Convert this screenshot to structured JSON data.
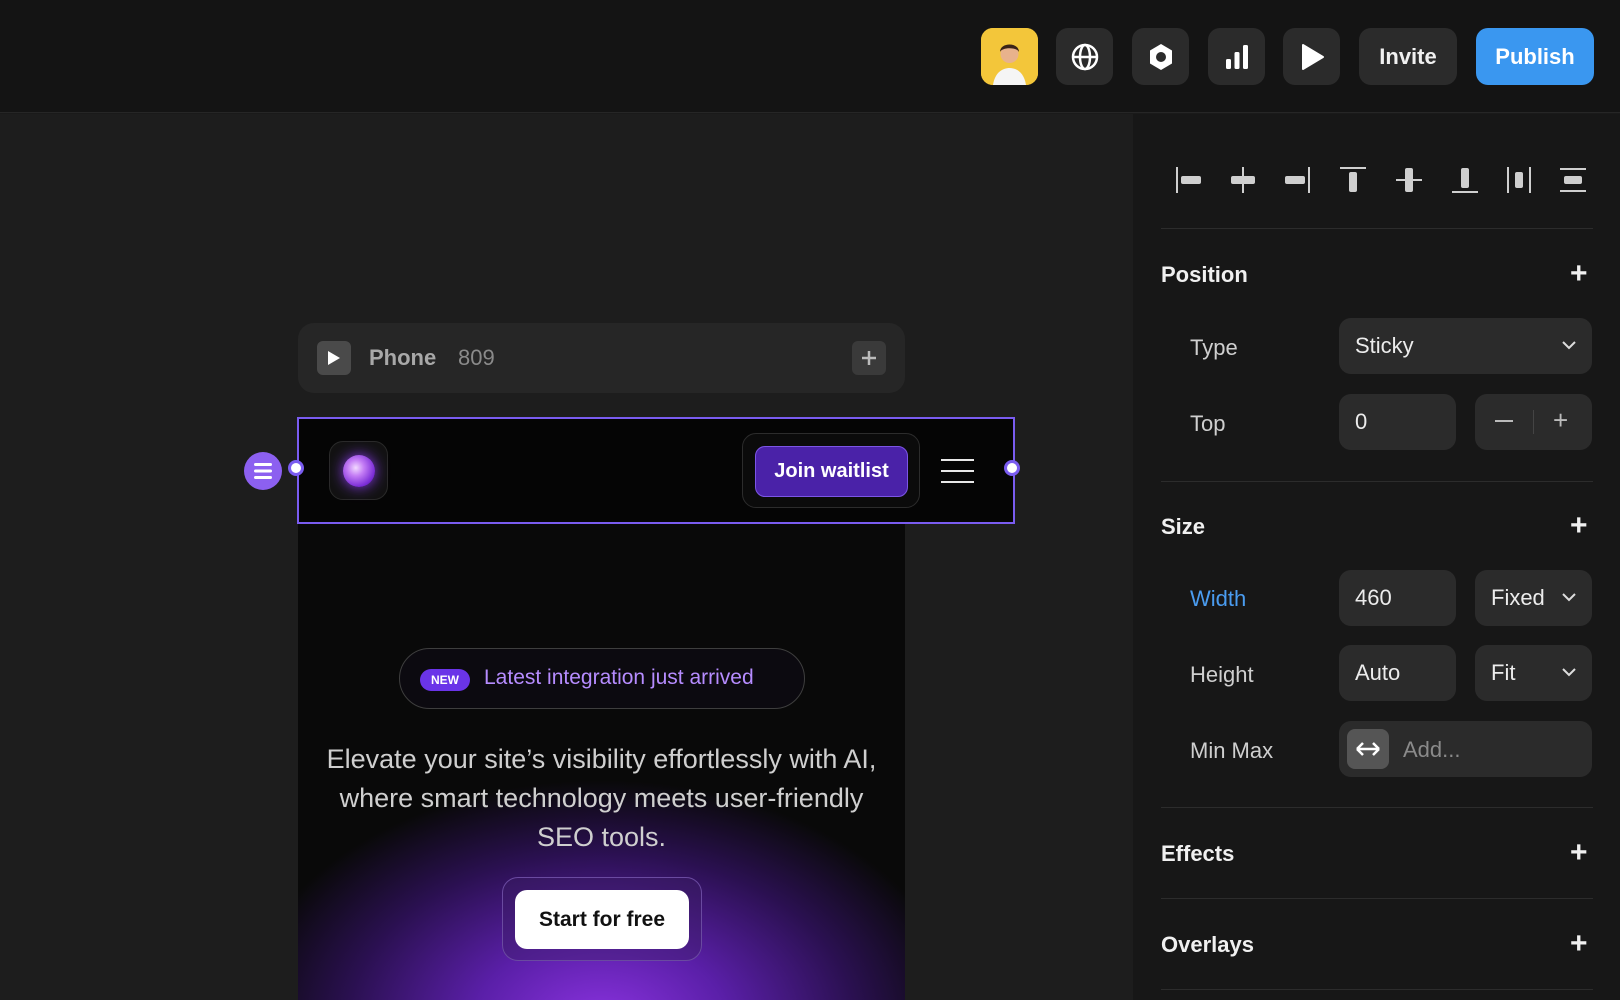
{
  "topbar": {
    "avatar": "user-avatar",
    "icons": [
      "globe-icon",
      "hexagon-icon",
      "bar-chart-icon",
      "play-icon"
    ],
    "invite_label": "Invite",
    "publish_label": "Publish"
  },
  "canvas": {
    "frame_label": {
      "name": "Phone",
      "width": "809"
    },
    "navbar": {
      "cta_label": "Join waitlist"
    },
    "badge": {
      "tag": "NEW",
      "text": "Latest integration just arrived"
    },
    "hero_text": "Elevate your site’s visibility effortlessly with AI, where smart technology meets user-friendly SEO tools.",
    "cta_label": "Start for free"
  },
  "panel": {
    "align_icons": [
      "align-left-icon",
      "align-center-h-icon",
      "align-right-icon",
      "align-top-icon",
      "align-center-v-icon",
      "align-bottom-icon",
      "distribute-h-icon",
      "distribute-v-icon"
    ],
    "position": {
      "title": "Position",
      "type_label": "Type",
      "type_value": "Sticky",
      "top_label": "Top",
      "top_value": "0"
    },
    "size": {
      "title": "Size",
      "width_label": "Width",
      "width_value": "460",
      "width_mode": "Fixed",
      "height_label": "Height",
      "height_value": "Auto",
      "height_mode": "Fit",
      "minmax_label": "Min Max",
      "minmax_placeholder": "Add..."
    },
    "effects_title": "Effects",
    "overlays_title": "Overlays"
  },
  "colors": {
    "accent_blue": "#3a97f0",
    "selection_purple": "#7a5cf0",
    "brand_purple": "#4a22a8"
  }
}
